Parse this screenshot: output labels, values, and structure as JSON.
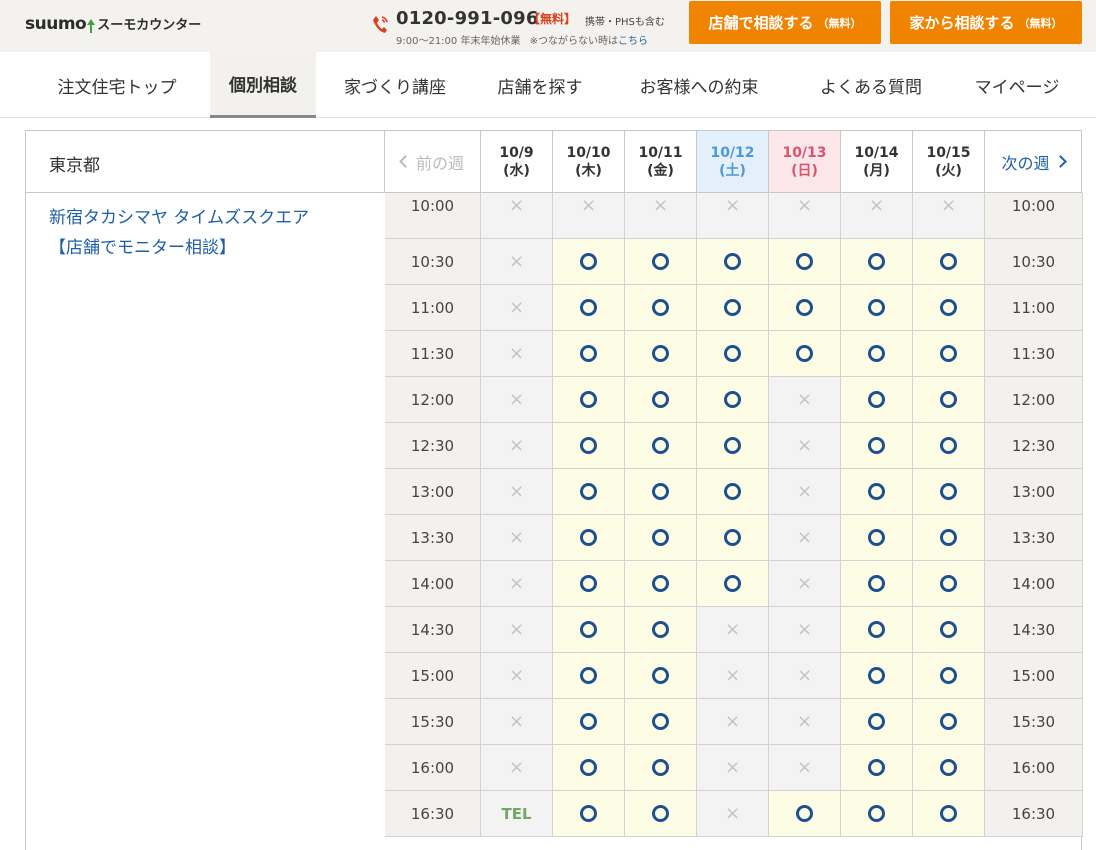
{
  "header": {
    "logo_text": "SUUMO",
    "logo_sub": "スーモカウンター",
    "phone": "0120-991-096",
    "free_label": "【無料】",
    "mobile_note": "携帯・PHSも含む",
    "hours": "9:00～21:00 年末年始休業",
    "fallback_note": "※つながらない時は",
    "fallback_link": "こちら",
    "cta_store": "店舗で相談する",
    "cta_store_sub": "（無料）",
    "cta_home": "家から相談する",
    "cta_home_sub": "（無料）",
    "accent_color": "#f08300"
  },
  "nav": {
    "items": [
      {
        "label": "注文住宅トップ",
        "active": false
      },
      {
        "label": "個別相談",
        "active": true
      },
      {
        "label": "家づくり講座",
        "active": false
      },
      {
        "label": "店舗を探す",
        "active": false
      },
      {
        "label": "お客様への約束",
        "active": false
      },
      {
        "label": "よくある質問",
        "active": false
      },
      {
        "label": "マイページ",
        "active": false
      }
    ]
  },
  "schedule": {
    "prefecture": "東京都",
    "store_name": "新宿タカシマヤ タイムズスクエア",
    "store_type": "【店舗でモニター相談】",
    "prev_week": "前の週",
    "next_week": "次の週",
    "days": [
      {
        "date": "10/9",
        "dow": "(水)",
        "kind": "weekday"
      },
      {
        "date": "10/10",
        "dow": "(木)",
        "kind": "weekday"
      },
      {
        "date": "10/11",
        "dow": "(金)",
        "kind": "weekday"
      },
      {
        "date": "10/12",
        "dow": "(土)",
        "kind": "sat"
      },
      {
        "date": "10/13",
        "dow": "(日)",
        "kind": "sun"
      },
      {
        "date": "10/14",
        "dow": "(月)",
        "kind": "weekday"
      },
      {
        "date": "10/15",
        "dow": "(火)",
        "kind": "weekday"
      }
    ],
    "rows": [
      {
        "time": "10:00",
        "slots": [
          "x",
          "x",
          "x",
          "x",
          "x",
          "x",
          "x"
        ]
      },
      {
        "time": "10:30",
        "slots": [
          "x",
          "o",
          "o",
          "o",
          "o",
          "o",
          "o"
        ]
      },
      {
        "time": "11:00",
        "slots": [
          "x",
          "o",
          "o",
          "o",
          "o",
          "o",
          "o"
        ]
      },
      {
        "time": "11:30",
        "slots": [
          "x",
          "o",
          "o",
          "o",
          "o",
          "o",
          "o"
        ]
      },
      {
        "time": "12:00",
        "slots": [
          "x",
          "o",
          "o",
          "o",
          "x",
          "o",
          "o"
        ]
      },
      {
        "time": "12:30",
        "slots": [
          "x",
          "o",
          "o",
          "o",
          "x",
          "o",
          "o"
        ]
      },
      {
        "time": "13:00",
        "slots": [
          "x",
          "o",
          "o",
          "o",
          "x",
          "o",
          "o"
        ]
      },
      {
        "time": "13:30",
        "slots": [
          "x",
          "o",
          "o",
          "o",
          "x",
          "o",
          "o"
        ]
      },
      {
        "time": "14:00",
        "slots": [
          "x",
          "o",
          "o",
          "o",
          "x",
          "o",
          "o"
        ]
      },
      {
        "time": "14:30",
        "slots": [
          "x",
          "o",
          "o",
          "x",
          "x",
          "o",
          "o"
        ]
      },
      {
        "time": "15:00",
        "slots": [
          "x",
          "o",
          "o",
          "x",
          "x",
          "o",
          "o"
        ]
      },
      {
        "time": "15:30",
        "slots": [
          "x",
          "o",
          "o",
          "x",
          "x",
          "o",
          "o"
        ]
      },
      {
        "time": "16:00",
        "slots": [
          "x",
          "o",
          "o",
          "x",
          "x",
          "o",
          "o"
        ]
      },
      {
        "time": "16:30",
        "slots": [
          "tel",
          "o",
          "o",
          "x",
          "o",
          "o",
          "o"
        ]
      }
    ],
    "tel_label": "TEL",
    "x_mark": "×"
  }
}
